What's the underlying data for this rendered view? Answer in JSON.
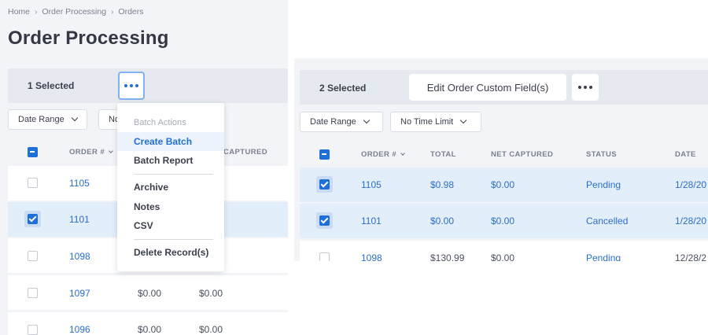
{
  "breadcrumb": [
    "Home",
    "Order Processing",
    "Orders"
  ],
  "page_title": "Order Processing",
  "left": {
    "selected_text": "1 Selected",
    "filters": {
      "date_range": "Date Range",
      "time_limit_partial": "No"
    },
    "columns": {
      "order": "ORDER #",
      "net_captured_partial": "CAPTURED"
    },
    "menu": {
      "header": "Batch Actions",
      "items": [
        "Create Batch",
        "Batch Report",
        "Archive",
        "Notes",
        "CSV",
        "Delete Record(s)"
      ]
    },
    "rows": [
      {
        "order": "1105",
        "total": "",
        "net": "",
        "checked": false
      },
      {
        "order": "1101",
        "total": "",
        "net": "",
        "checked": true
      },
      {
        "order": "1098",
        "total": "",
        "net": "",
        "checked": false
      },
      {
        "order": "1097",
        "total": "$0.00",
        "net": "$0.00",
        "checked": false
      },
      {
        "order": "1096",
        "total": "$0.00",
        "net": "$0.00",
        "checked": false
      }
    ]
  },
  "right": {
    "selected_text": "2 Selected",
    "edit_button": "Edit Order Custom Field(s)",
    "filters": {
      "date_range": "Date Range",
      "time_limit": "No Time Limit"
    },
    "columns": {
      "order": "ORDER #",
      "total": "TOTAL",
      "net_captured": "NET CAPTURED",
      "status": "STATUS",
      "date": "DATE"
    },
    "rows": [
      {
        "order": "1105",
        "total": "$0.98",
        "net": "$0.00",
        "status": "Pending",
        "date": "1/28/20",
        "checked": true
      },
      {
        "order": "1101",
        "total": "$0.00",
        "net": "$0.00",
        "status": "Cancelled",
        "date": "1/28/20",
        "checked": true
      },
      {
        "order": "1098",
        "total": "$130.99",
        "net": "$0.00",
        "status": "Pending",
        "date": "12/28/2",
        "checked": false
      }
    ]
  },
  "colors": {
    "accent": "#1f6fd8",
    "link": "#2a6fcb",
    "selected_row": "#e3eefb",
    "panel_bg": "#f2f4f8"
  }
}
